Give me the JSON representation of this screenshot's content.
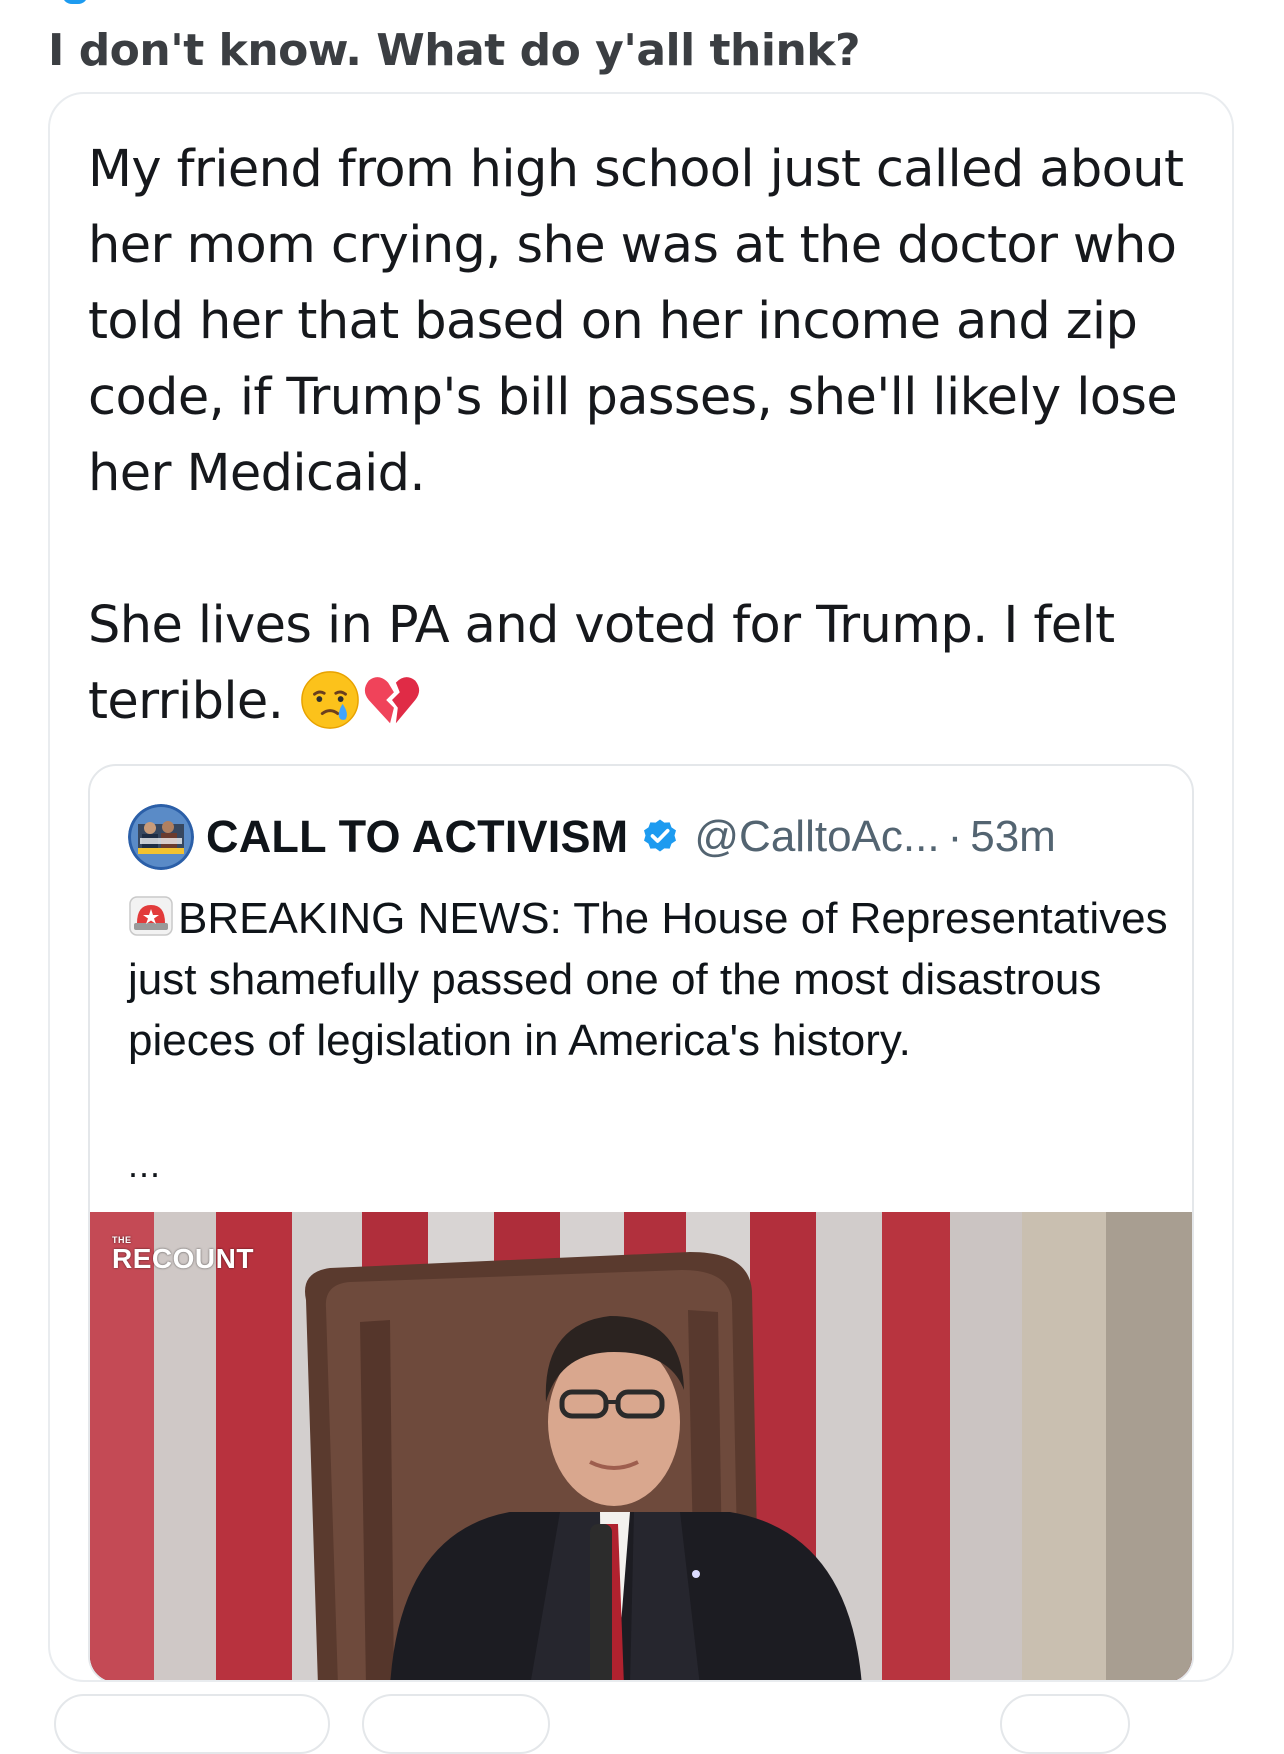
{
  "post": {
    "title": "I don't know. What do y'all think?",
    "text_paragraph_1": "My friend from high school just called about her mom crying, she was at the doctor who told her that based on her income and zip code, if Trump's bill passes, she'll likely lose her Medicaid.",
    "text_paragraph_2": "She lives in PA and voted for Trump. I felt terrible.",
    "emojis": [
      "crying-face-icon",
      "broken-heart-icon"
    ]
  },
  "quoted_tweet": {
    "author_name": "CALL TO ACTIVISM",
    "verified": true,
    "handle": "@CalltoAc...",
    "separator": "·",
    "time": "53m",
    "body_icon": "police-light-icon",
    "body_text": "BREAKING NEWS: The House of Representatives just shamefully passed one of the most disastrous pieces of legislation in America's history.",
    "ellipsis": "...",
    "media": {
      "watermark_small": "THE",
      "watermark": "RECOUNT"
    }
  },
  "colors": {
    "verified_badge": "#1d9bf0",
    "secondary_text": "#536471",
    "card_border": "#e4e7ea",
    "title_text": "#3b3e42"
  }
}
